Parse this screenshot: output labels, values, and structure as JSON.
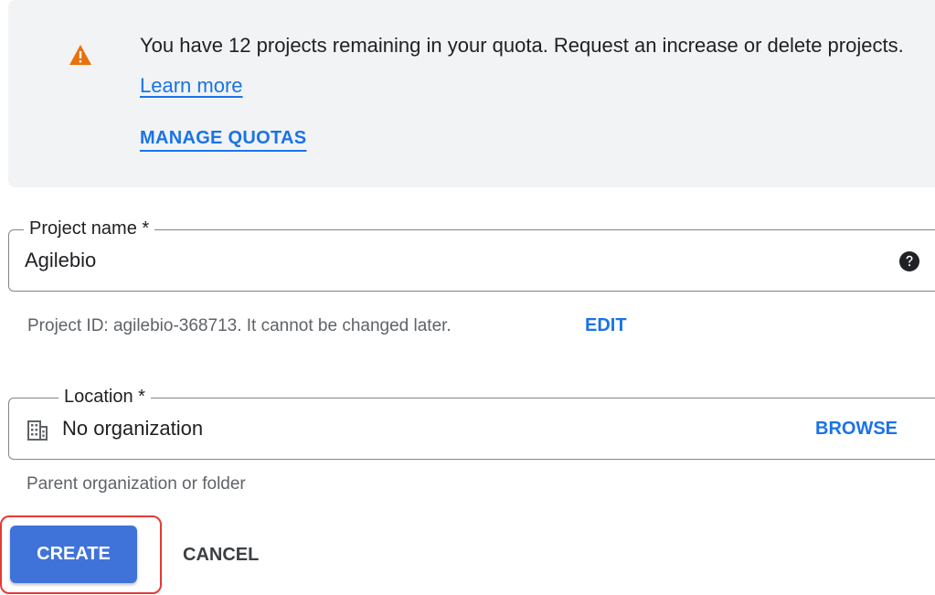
{
  "quota_banner": {
    "icon": "warning-triangle-icon",
    "message": "You have 12 projects remaining in your quota. Request an increase or delete projects.",
    "learn_more_label": "Learn more",
    "manage_quotas_label": "MANAGE QUOTAS",
    "warning_color": "#e8710a"
  },
  "project_name_field": {
    "label": "Project name *",
    "value": "Agilebio",
    "help_icon": "help-circle-icon"
  },
  "project_id_hint": {
    "text": "Project ID: agilebio-368713. It cannot be changed later.",
    "edit_label": "EDIT"
  },
  "location_field": {
    "label": "Location *",
    "icon": "building-icon",
    "value": "No organization",
    "browse_label": "BROWSE",
    "hint": "Parent organization or folder"
  },
  "actions": {
    "create_label": "CREATE",
    "cancel_label": "CANCEL"
  },
  "colors": {
    "accent": "#1a73e8",
    "primary_button": "#3f73d9",
    "highlight_border": "#e53935",
    "banner_background": "#f1f3f4"
  }
}
